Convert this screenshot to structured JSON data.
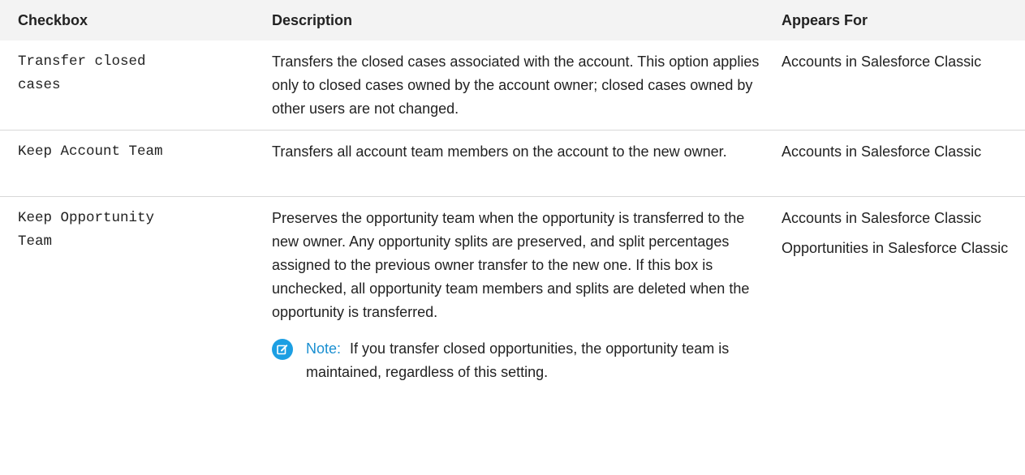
{
  "table": {
    "headers": {
      "checkbox": "Checkbox",
      "description": "Description",
      "appears_for": "Appears For"
    },
    "rows": [
      {
        "checkbox_lines": [
          "Transfer closed",
          "cases"
        ],
        "description": "Transfers the closed cases associated with the account. This option applies only to closed cases owned by the account owner; closed cases owned by other users are not changed.",
        "appears_for": [
          "Accounts in Salesforce Classic"
        ]
      },
      {
        "checkbox_lines": [
          "Keep Account Team"
        ],
        "description": "Transfers all account team members on the account to the new owner.",
        "appears_for": [
          "Accounts in Salesforce Classic"
        ]
      },
      {
        "checkbox_lines": [
          "Keep Opportunity",
          "Team"
        ],
        "description": "Preserves the opportunity team when the opportunity is transferred to the new owner. Any opportunity splits are preserved, and split percentages assigned to the previous owner transfer to the new one. If this box is unchecked, all opportunity team members and splits are deleted when the opportunity is transferred.",
        "note": {
          "label": "Note:",
          "text": "If you transfer closed opportunities, the opportunity team is maintained, regardless of this setting."
        },
        "appears_for": [
          "Accounts in Salesforce Classic",
          "Opportunities in Salesforce Classic"
        ]
      }
    ]
  },
  "icons": {
    "note": "edit-note-icon"
  },
  "colors": {
    "header_bg": "#f3f3f3",
    "note_label": "#1a8fd1",
    "note_icon_bg": "#1c9fe3",
    "divider": "#d8d8d8"
  }
}
